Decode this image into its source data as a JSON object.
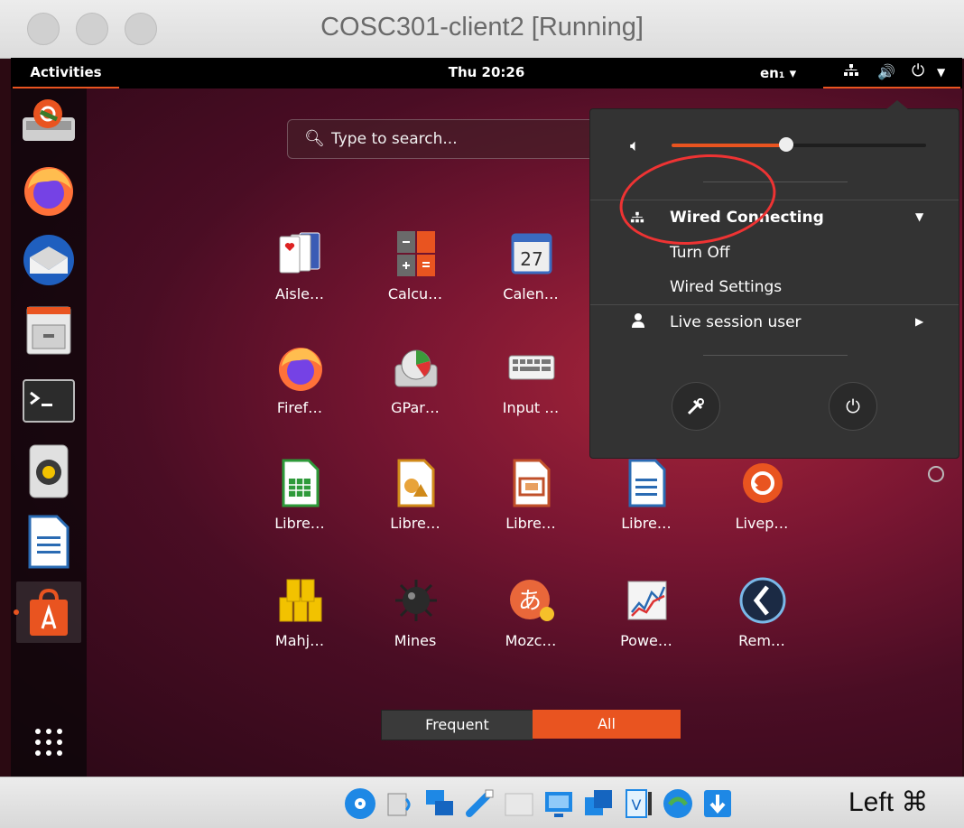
{
  "window": {
    "title": "COSC301-client2 [Running]"
  },
  "topbar": {
    "activities": "Activities",
    "clock": "Thu 20:26",
    "language": "en₁ ▾"
  },
  "search": {
    "placeholder": "Type to search..."
  },
  "apps": [
    {
      "label": "Aisle…",
      "icon": "solitaire-cards-icon"
    },
    {
      "label": "Calcu…",
      "icon": "calculator-icon"
    },
    {
      "label": "Calen…",
      "icon": "calendar-icon",
      "badge": "27"
    },
    {
      "label": "Firef…",
      "icon": "firefox-icon"
    },
    {
      "label": "GPar…",
      "icon": "gparted-disk-icon"
    },
    {
      "label": "Input …",
      "icon": "keyboard-icon"
    },
    {
      "label": "Libre…",
      "icon": "libreoffice-calc-icon"
    },
    {
      "label": "Libre…",
      "icon": "libreoffice-impress-icon"
    },
    {
      "label": "Libre…",
      "icon": "libreoffice-draw-icon"
    },
    {
      "label": "Libre…",
      "icon": "libreoffice-writer-icon"
    },
    {
      "label": "Livep…",
      "icon": "livepatch-icon"
    },
    {
      "label": "Mahj…",
      "icon": "mahjongg-tiles-icon"
    },
    {
      "label": "Mines",
      "icon": "mines-icon"
    },
    {
      "label": "Mozc…",
      "icon": "mozc-icon"
    },
    {
      "label": "Powe…",
      "icon": "power-statistics-icon"
    },
    {
      "label": "Rem…",
      "icon": "remmina-icon"
    }
  ],
  "switcher": {
    "frequent": "Frequent",
    "all": "All"
  },
  "menu": {
    "volume_level": 0.45,
    "wired_title": "Wired Connecting",
    "turn_off": "Turn Off",
    "wired_settings": "Wired Settings",
    "user": "Live session user"
  },
  "statusbar": {
    "host_key": "Left ⌘"
  },
  "colors": {
    "accent": "#e95420",
    "menu_bg": "#333333",
    "annotation": "#ee3333"
  }
}
